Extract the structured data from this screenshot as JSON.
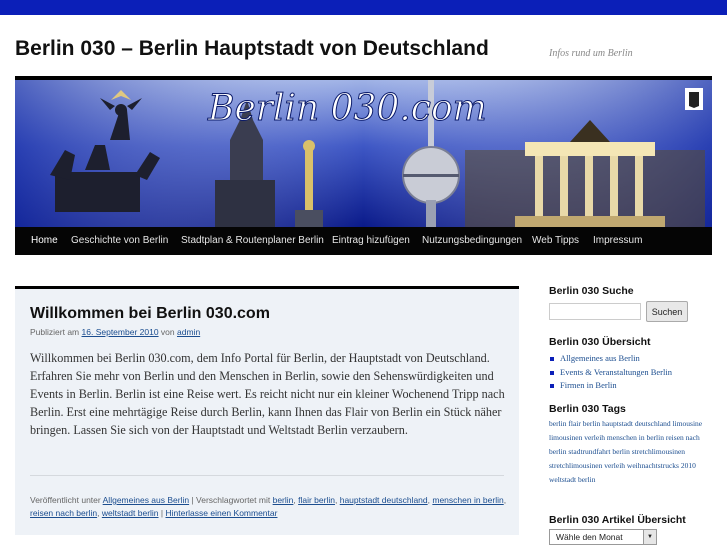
{
  "site": {
    "title": "Berlin 030 – Berlin Hauptstadt von Deutschland",
    "description": "Infos rund um Berlin",
    "banner_text": "Berlin 030.com"
  },
  "nav": {
    "items": [
      {
        "label": "Home"
      },
      {
        "label": "Geschichte von Berlin"
      },
      {
        "label": "Stadtplan & Routenplaner Berlin"
      },
      {
        "label": "Eintrag hizufügen"
      },
      {
        "label": "Nutzungsbedingungen"
      },
      {
        "label": "Web Tipps"
      },
      {
        "label": "Impressum"
      }
    ]
  },
  "post": {
    "title": "Willkommen bei Berlin 030.com",
    "meta_prefix": "Publiziert am",
    "date": "16. September 2010",
    "meta_by": "von",
    "author": "admin",
    "body": "Willkommen bei Berlin 030.com, dem Info Portal für Berlin, der Hauptstadt von Deutschland. Erfahren Sie mehr von Berlin und den Menschen in Berlin, sowie den Sehenswürdigkeiten und Events in Berlin. Berlin ist eine Reise wert. Es reicht nicht nur ein kleiner Wochenend Tripp nach Berlin. Erst eine mehrtägige Reise durch Berlin, kann Ihnen das Flair von Berlin ein Stück näher bringen. Lassen Sie sich von der Hauptstadt und Weltstadt Berlin verzaubern.",
    "footer": {
      "posted_in": "Veröffentlicht unter",
      "category": "Allgemeines aus Berlin",
      "tagged": "Verschlagwortet mit",
      "tags": [
        "berlin",
        "flair berlin",
        "hauptstadt deutschland",
        "menschen in berlin",
        "reisen nach berlin",
        "weltstadt berlin"
      ],
      "comment_link": "Hinterlasse einen Kommentar"
    }
  },
  "sidebar": {
    "search_title": "Berlin 030 Suche",
    "search_placeholder": "",
    "search_button": "Suchen",
    "overview_title": "Berlin 030 Übersicht",
    "categories": [
      "Allgemeines aus Berlin",
      "Events & Veranstaltungen Berlin",
      "Firmen in Berlin"
    ],
    "tags_title": "Berlin 030 Tags",
    "tags": [
      "berlin",
      "flair berlin",
      "hauptstadt deutschland",
      "limousine",
      "limousinen verleih",
      "menschen in berlin",
      "reisen nach berlin",
      "stadtrundfahrt berlin",
      "stretchlimousinen",
      "stretchlimousinen verleih",
      "weihnachtstrucks 2010",
      "weltstadt berlin"
    ],
    "archive_title": "Berlin 030 Artikel Übersicht",
    "archive_select": "Wähle den Monat"
  },
  "colors": {
    "top_bar": "#0b1fb8",
    "nav_background": "#050505",
    "post_background": "#eef2f7",
    "link": "#1b4d8f"
  }
}
